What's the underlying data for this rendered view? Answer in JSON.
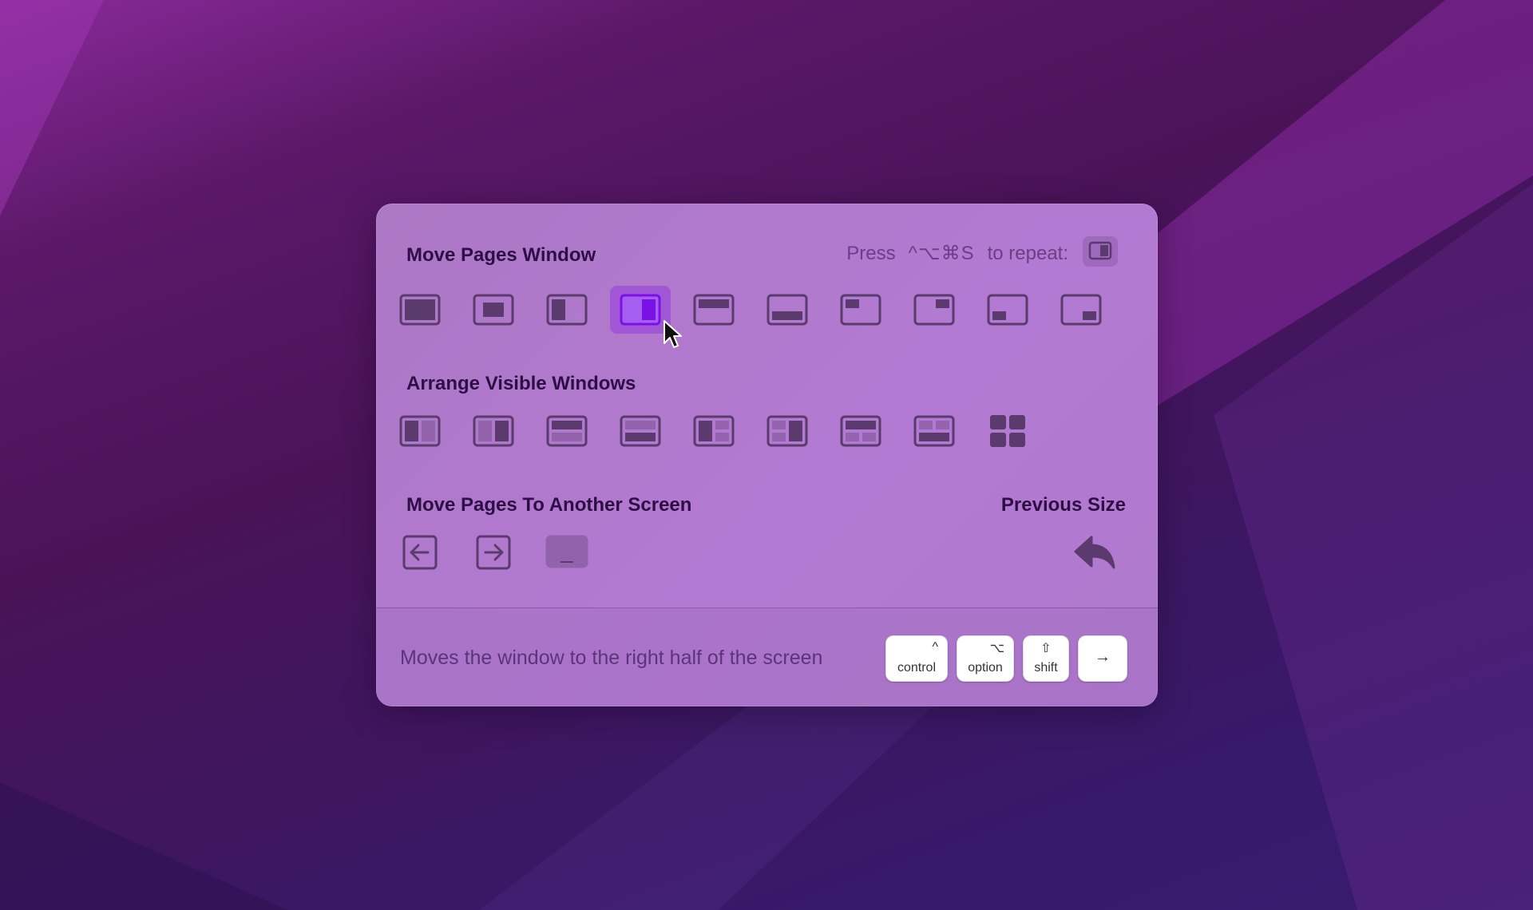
{
  "panel": {
    "move_title": "Move Pages Window",
    "repeat": {
      "press": "Press",
      "keys": "^⌥⌘S",
      "suffix": "to repeat:"
    },
    "arrange_title": "Arrange Visible Windows",
    "screen_title": "Move Pages To Another Screen",
    "previous_title": "Previous Size",
    "description": "Moves the window to the right half of the screen"
  },
  "move_buttons": [
    "maximize",
    "center",
    "left-half",
    "right-half",
    "top-half",
    "bottom-half",
    "top-left",
    "top-right",
    "bottom-left",
    "bottom-right"
  ],
  "selected_move_button": "right-half",
  "arrange_buttons": [
    "tile-left-split",
    "tile-right-split",
    "tile-top-split",
    "tile-bottom-split",
    "tile-left-quarters",
    "tile-right-quarters",
    "tile-top-quarters",
    "tile-bottom-quarters",
    "tile-grid"
  ],
  "screen_buttons": [
    "previous-screen",
    "next-screen",
    "built-in-display"
  ],
  "shortcut": [
    {
      "symbol": "^",
      "label": "control"
    },
    {
      "symbol": "⌥",
      "label": "option"
    },
    {
      "symbol": "⇧",
      "label": "shift"
    },
    {
      "symbol": "→",
      "label": ""
    }
  ],
  "colors": {
    "accent": "#8a1ff0",
    "icon": "#5b3a6e",
    "title": "#2e0f45"
  }
}
